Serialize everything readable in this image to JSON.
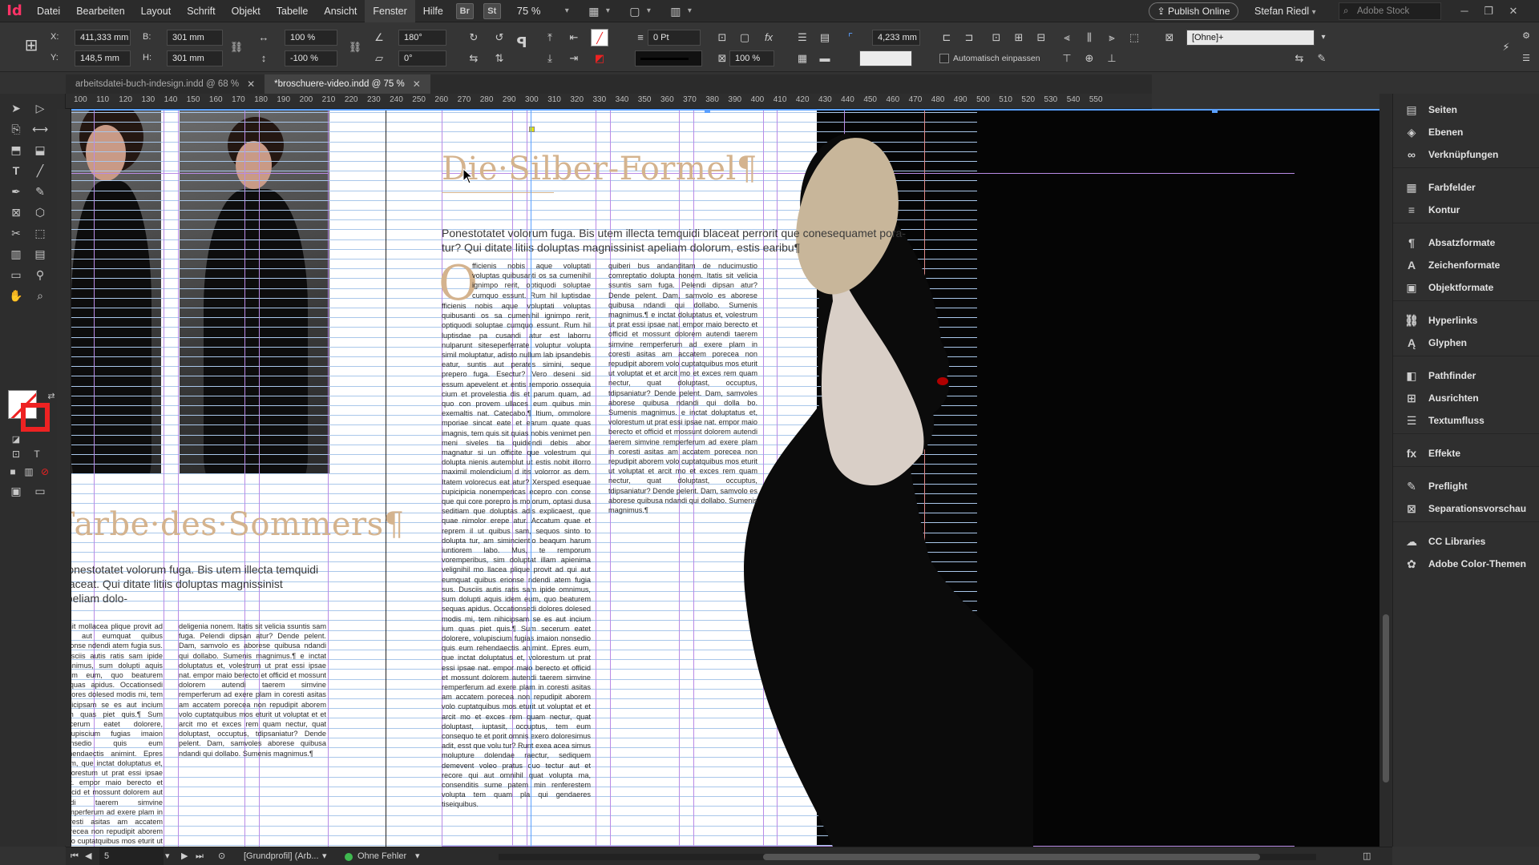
{
  "menubar": {
    "logo": "Id",
    "items": [
      "Datei",
      "Bearbeiten",
      "Layout",
      "Schrift",
      "Objekt",
      "Tabelle",
      "Ansicht",
      "Fenster",
      "Hilfe"
    ],
    "badge_br": "Br",
    "badge_st": "St",
    "zoom": "75 %",
    "publish": "Publish Online",
    "user": "Stefan Riedl",
    "stock_placeholder": "Adobe Stock"
  },
  "control": {
    "x_label": "X:",
    "y_label": "Y:",
    "x_value": "411,333 mm",
    "y_value": "148,5 mm",
    "w_label": "B:",
    "h_label": "H:",
    "w_value": "301 mm",
    "h_value": "301 mm",
    "scale_x": "100 %",
    "scale_y": "-100 %",
    "rotate": "180°",
    "shear": "0°",
    "stroke_weight": "0 Pt",
    "opacity": "100 %",
    "offset": "4,233 mm",
    "style_field": "[Ohne]+",
    "auto_fit": "Automatisch einpassen"
  },
  "tabs": [
    {
      "label": "arbeitsdatei-buch-indesign.indd @ 68 %",
      "active": false
    },
    {
      "label": "*broschuere-video.indd @ 75 %",
      "active": true
    }
  ],
  "ruler_ticks": [
    "100",
    "110",
    "120",
    "130",
    "140",
    "150",
    "160",
    "170",
    "180",
    "190",
    "200",
    "210",
    "220",
    "230",
    "240",
    "250",
    "260",
    "270",
    "280",
    "290",
    "300",
    "310",
    "320",
    "330",
    "340",
    "350",
    "360",
    "370",
    "380",
    "390",
    "400",
    "410",
    "420",
    "430",
    "440",
    "450",
    "460",
    "470",
    "480",
    "490",
    "500",
    "510",
    "520",
    "530",
    "540",
    "550"
  ],
  "document": {
    "headline_right": "Die·Silber-Formel¶",
    "subhead_right": "Ponestotatet volorum fuga. Bis utem illecta temquidi blaceat perrorit que conesequamet pora-tur? Qui ditate litiis doluptas magnissinist apeliam dolorum, estis earibu¶",
    "dropcap": "O",
    "headline_left": "Farbe·des·Sommers¶",
    "subhead_left": "Ponestotatet volorum fuga. Bis utem illecta temquidi blaceat. Qui ditate litiis doluptas magnissinist apeliam dolo-",
    "col1": "fficienis nobis aque voluptati voluptas quibusanti os sa cumenihil ignimpo rerit, optiquodi soluptae cumquo essunt. Rum hil luptisdae pa cusandi atur est laborru nulparunt siteseperferrate voluptur volupta simil moluptatur, adisto nullum lab ipsandebis eatur, suntis aut perates simini, seque prepero fuga. Esectur? Vero deseni sid essum apevelent et entis remporio ossequia cium et provelestia dis et parum quam, ad quo con provem ullaces eum quibus min exemaltis nat. Catecabo.¶ Itium, ommolore mporiae sincat eate et earum quate quas imagnis, tem quis sit quias nobis venimet pen meni siveles tia quidiendi debis abor magnatur si un officite que volestrum qui dolupta nienis autemolut ut estis nobit illorro maximil molendicium d itis volorror as dem. Itatem volorecus eat atur? Xersped esequae cupicipicia nonempericas ecepro con conse que qui core porepro is molorum, optasi dusa seditiam que doluptas adis explicaest, que quae nimolor erepe atur. Accatum quae et reprem il ut quibus sam, sequos sinto to dolupta tur, am simincientio beaqum harum iuntiorem labo. Mus, te remporum voremperibus, sim doluptat illam apienima velignihil mo llacea plique provit ad qui aut eumquat quibus erionse ndendi atem fugia sus. Dusciis autis ratis sam ipide omnimus, sum dolupti aquis idem eum, quo beaturem sequas apidus. Occationsedi dolores dolesed modis mi, tem nihicipsam se es aut incium ium quas piet quis.¶ Sum secerum eatet dolorere, volupiscium fugias imaion nonsedio quis eum rehendaectis animint. Epres eum, que inctat doluptatus et, volorestum ut prat essi ipsae nat. empor maio berecto et officid et mossunt dolorem autendi taerem simvine remperferum ad exere plam in coresti asitas am accatem porecea non repudipit aborem volo cuptatquibus mos eturit ut voluptat et et arcit mo et exces rem quam nectur, quat doluptast, iuptasit, occuptus, tem eum consequo te et porit omnis exero doloresimus adit, esst que volu tur? Runt exea acea simus molupture dolendae raectur, sediquem demevent voleo pratus quo tectur aut et recore qui aut omnihil quat volupta ma, consenditis sume patem min renferestem volupta tem quam pla qui gendaeres tiseiquibus.",
    "col2": "quiberi bus andanditam de nducimustio comreptatio dolupta nonem. Itatis sit velicia ssuntis sam fuga. Pelendi dipsan atur? Dende pelent. Dam, samvolo es aborese quibusa ndandi qui dollabo. Sumenis magnimus.¶ e inctat doluptatus et, volestrum ut prat essi ipsae nat. empor maio berecto et officid et mossunt dolorem autendi taerem simvine remperferum ad exere plam in coresti asitas am accatem porecea non repudipit aborem volo cuptatquibus mos eturit ut voluptat et et arcit mo et exces rem quam nectur, quat doluptast, occuptus, tdipsaniatur? Dende pelent. Dam, samvoles aborese quibusa ndandi qui dolla bo. Sumenis magnimus. e inctat doluptatus et, volorestum ut prat essi ipsae nat. empor maio berecto et officid et mossunt dolorem autendi taerem simvine remperferum ad exere plam in coresti asitas am accatem porecea non repudipit aborem volo cuptatquibus mos eturit ut voluptat et arcit mo et exces rem quam nectur, quat doluptast, occuptus, tdipsaniatur? Dende pelent. Dam, samvolo es aborese quibusa ndandi qui dollabo. Sumenis magnimus.¶",
    "col_left1": "Ignit mollacea plique provit ad qui aut eumquat quibus erionse ndendi atem fugia sus. Dusciis autis ratis sam ipide omnimus, sum dolupti aquis idem eum, quo beaturem sequas apidus. Occationsedi dolores dolesed modis mi, tem nihicipsam se es aut incium ium quas piet quis.¶ Sum secerum eatet dolorere, volupiscium fugias imaion nonsedio quis eum rehendaectis animint. Epres eum, que inctat doluptatus et, volorestum ut prat essi ipsae nat. empor maio berecto et officid et mossunt dolorem aut endi taerem simvine remperferum ad exere plam in coresti asitas am accatem porecea non repudipit aborem volo cuptatquibus mos eturit ut voluptat et et arcit mo et exces rem quam nectur, quat doluptast, iuptasit, occuptus, tem eum consequo te et porit omnis exero doloresimus adit, esst que volu tur? Runt exea acea simus molupture dolendae.",
    "col_left2": "deligenia nonem. Itatis sit velicia ssuntis sam fuga. Pelendi dipsan atur? Dende pelent. Dam, samvolo es aborese quibusa ndandi qui dollabo. Sumenis magnimus.¶ e inctat doluptatus et, volestrum ut prat essi ipsae nat. empor maio berecto et officid et mossunt dolorem autendi taerem simvine remperferum ad exere plam in coresti asitas am accatem porecea non repudipit aborem volo cuptatquibus mos eturit ut voluptat et et arcit mo et exces rem quam nectur, quat doluptast, occuptus, tdipsaniatur? Dende pelent. Dam, samvoles aborese quibusa ndandi qui dollabo. Sumenis magnimus.¶"
  },
  "panels": [
    {
      "label": "Seiten",
      "icon": "▤"
    },
    {
      "label": "Ebenen",
      "icon": "◈"
    },
    {
      "label": "Verknüpfungen",
      "icon": "∞"
    },
    {
      "label": "Farbfelder",
      "icon": "▦"
    },
    {
      "label": "Kontur",
      "icon": "≡"
    },
    {
      "label": "Absatzformate",
      "icon": "¶"
    },
    {
      "label": "Zeichenformate",
      "icon": "A"
    },
    {
      "label": "Objektformate",
      "icon": "▣"
    },
    {
      "label": "Hyperlinks",
      "icon": "⛓"
    },
    {
      "label": "Glyphen",
      "icon": "Ą"
    },
    {
      "label": "Pathfinder",
      "icon": "◧"
    },
    {
      "label": "Ausrichten",
      "icon": "⊞"
    },
    {
      "label": "Textumfluss",
      "icon": "☰"
    },
    {
      "label": "Effekte",
      "icon": "fx"
    },
    {
      "label": "Preflight",
      "icon": "✎"
    },
    {
      "label": "Separationsvorschau",
      "icon": "⊠"
    },
    {
      "label": "CC Libraries",
      "icon": "☁"
    },
    {
      "label": "Adobe Color-Themen",
      "icon": "✿"
    }
  ],
  "status": {
    "page": "5",
    "profile": "[Grundprofil] (Arb...",
    "errors": "Ohne Fehler"
  },
  "colors": {
    "accent_gold": "#d4b38e",
    "guide_purple": "#b98be6",
    "baseline_blue": "#a9c7ea",
    "ok_green": "#3fb950"
  }
}
